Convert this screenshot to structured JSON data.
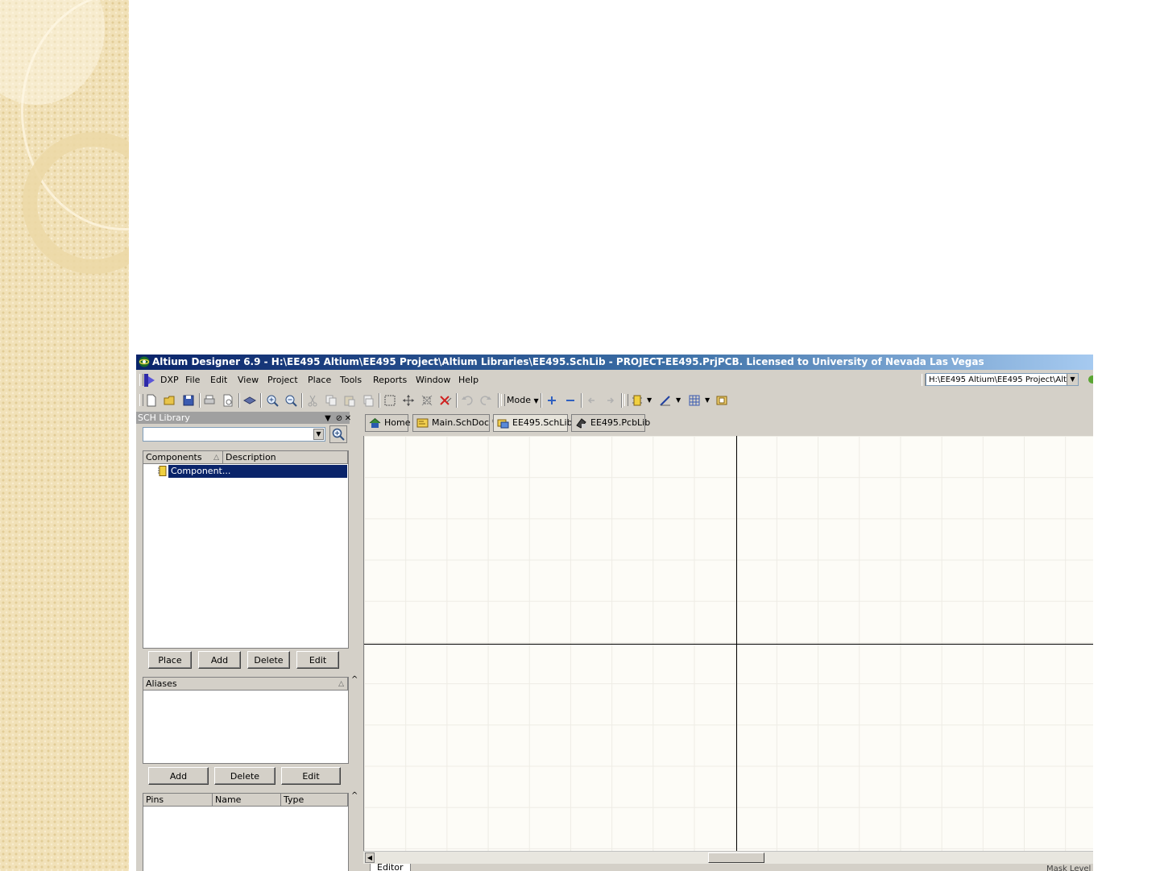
{
  "window": {
    "title": "Altium Designer 6.9 - H:\\EE495 Altium\\EE495 Project\\Altium Libraries\\EE495.SchLib - PROJECT-EE495.PrjPCB. Licensed to University of Nevada Las Vegas"
  },
  "menu": {
    "items": [
      "DXP",
      "File",
      "Edit",
      "View",
      "Project",
      "Place",
      "Tools",
      "Reports",
      "Window",
      "Help"
    ]
  },
  "path_combo": {
    "value": "H:\\EE495 Altium\\EE495 Project\\Altium"
  },
  "toolbar": {
    "mode_label": "Mode"
  },
  "panel": {
    "title": "SCH Library",
    "components_header": "Components",
    "description_header": "Description",
    "selected_component": "Component...",
    "buttons": {
      "place": "Place",
      "add": "Add",
      "delete": "Delete",
      "edit": "Edit"
    },
    "aliases_header": "Aliases",
    "alias_buttons": {
      "add": "Add",
      "delete": "Delete",
      "edit": "Edit"
    },
    "pins_headers": {
      "pins": "Pins",
      "name": "Name",
      "type": "Type"
    }
  },
  "tabs": [
    {
      "label": "Home",
      "icon": "home-icon"
    },
    {
      "label": "Main.SchDoc *",
      "icon": "schematic-doc-icon"
    },
    {
      "label": "EE495.SchLib",
      "icon": "schlib-icon"
    },
    {
      "label": "EE495.PcbLib",
      "icon": "pcblib-icon"
    }
  ],
  "status": {
    "editor_tab": "Editor",
    "mask_level": "Mask Level"
  },
  "colors": {
    "selection": "#0a246a",
    "title_start": "#0a246a",
    "chrome": "#d4d0c8",
    "canvas": "#fdfcf7"
  }
}
